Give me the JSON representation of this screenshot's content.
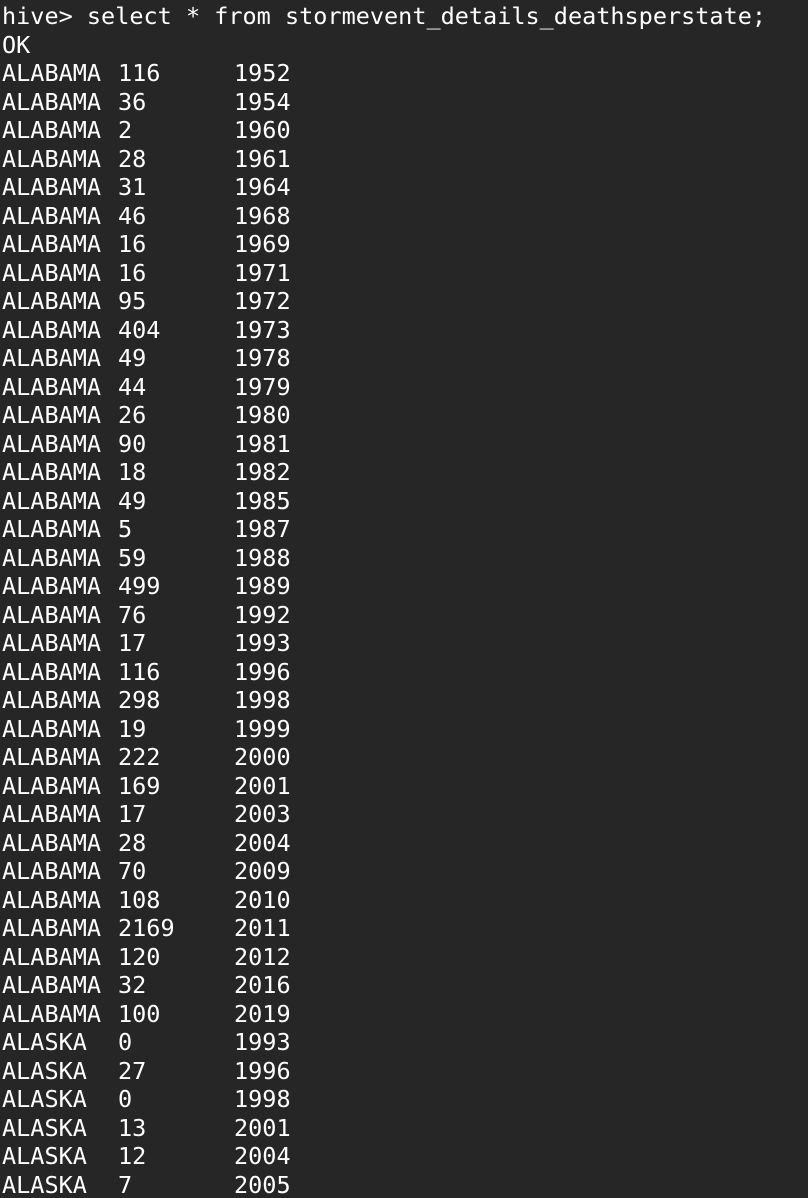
{
  "terminal": {
    "prompt": "hive>",
    "command": "select * from stormevent_details_deathsperstate;",
    "status": "OK"
  },
  "result_rows": [
    {
      "state": "ALABAMA",
      "deaths": "116",
      "year": "1952"
    },
    {
      "state": "ALABAMA",
      "deaths": "36",
      "year": "1954"
    },
    {
      "state": "ALABAMA",
      "deaths": "2",
      "year": "1960"
    },
    {
      "state": "ALABAMA",
      "deaths": "28",
      "year": "1961"
    },
    {
      "state": "ALABAMA",
      "deaths": "31",
      "year": "1964"
    },
    {
      "state": "ALABAMA",
      "deaths": "46",
      "year": "1968"
    },
    {
      "state": "ALABAMA",
      "deaths": "16",
      "year": "1969"
    },
    {
      "state": "ALABAMA",
      "deaths": "16",
      "year": "1971"
    },
    {
      "state": "ALABAMA",
      "deaths": "95",
      "year": "1972"
    },
    {
      "state": "ALABAMA",
      "deaths": "404",
      "year": "1973"
    },
    {
      "state": "ALABAMA",
      "deaths": "49",
      "year": "1978"
    },
    {
      "state": "ALABAMA",
      "deaths": "44",
      "year": "1979"
    },
    {
      "state": "ALABAMA",
      "deaths": "26",
      "year": "1980"
    },
    {
      "state": "ALABAMA",
      "deaths": "90",
      "year": "1981"
    },
    {
      "state": "ALABAMA",
      "deaths": "18",
      "year": "1982"
    },
    {
      "state": "ALABAMA",
      "deaths": "49",
      "year": "1985"
    },
    {
      "state": "ALABAMA",
      "deaths": "5",
      "year": "1987"
    },
    {
      "state": "ALABAMA",
      "deaths": "59",
      "year": "1988"
    },
    {
      "state": "ALABAMA",
      "deaths": "499",
      "year": "1989"
    },
    {
      "state": "ALABAMA",
      "deaths": "76",
      "year": "1992"
    },
    {
      "state": "ALABAMA",
      "deaths": "17",
      "year": "1993"
    },
    {
      "state": "ALABAMA",
      "deaths": "116",
      "year": "1996"
    },
    {
      "state": "ALABAMA",
      "deaths": "298",
      "year": "1998"
    },
    {
      "state": "ALABAMA",
      "deaths": "19",
      "year": "1999"
    },
    {
      "state": "ALABAMA",
      "deaths": "222",
      "year": "2000"
    },
    {
      "state": "ALABAMA",
      "deaths": "169",
      "year": "2001"
    },
    {
      "state": "ALABAMA",
      "deaths": "17",
      "year": "2003"
    },
    {
      "state": "ALABAMA",
      "deaths": "28",
      "year": "2004"
    },
    {
      "state": "ALABAMA",
      "deaths": "70",
      "year": "2009"
    },
    {
      "state": "ALABAMA",
      "deaths": "108",
      "year": "2010"
    },
    {
      "state": "ALABAMA",
      "deaths": "2169",
      "year": "2011"
    },
    {
      "state": "ALABAMA",
      "deaths": "120",
      "year": "2012"
    },
    {
      "state": "ALABAMA",
      "deaths": "32",
      "year": "2016"
    },
    {
      "state": "ALABAMA",
      "deaths": "100",
      "year": "2019"
    },
    {
      "state": "ALASKA",
      "deaths": "0",
      "year": "1993"
    },
    {
      "state": "ALASKA",
      "deaths": "27",
      "year": "1996"
    },
    {
      "state": "ALASKA",
      "deaths": "0",
      "year": "1998"
    },
    {
      "state": "ALASKA",
      "deaths": "13",
      "year": "2001"
    },
    {
      "state": "ALASKA",
      "deaths": "12",
      "year": "2004"
    },
    {
      "state": "ALASKA",
      "deaths": "7",
      "year": "2005"
    }
  ],
  "colors": {
    "background": "#262626",
    "foreground": "#ffffff"
  }
}
